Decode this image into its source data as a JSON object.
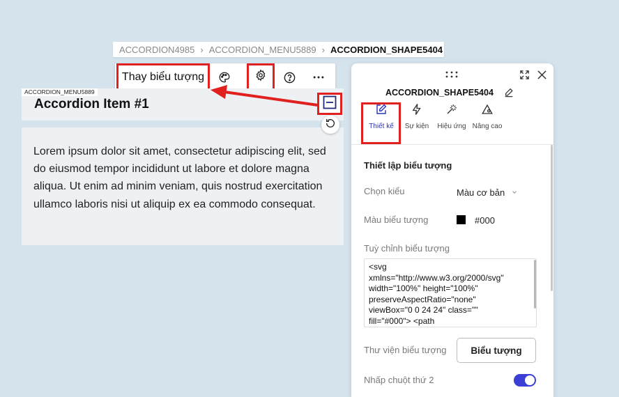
{
  "breadcrumb": {
    "items": [
      "ACCORDION4985",
      "ACCORDION_MENU5889"
    ],
    "current": "ACCORDION_SHAPE5404",
    "separator": "›"
  },
  "toolbar": {
    "change_icon_label": "Thay biểu tượng",
    "icons": [
      "palette-icon",
      "gear-icon",
      "help-icon",
      "more-icon"
    ]
  },
  "accordion": {
    "menu_tag": "ACCORDION_MENU5889",
    "item_title": "Accordion Item #1",
    "body_text": "Lorem ipsum dolor sit amet, consectetur adipiscing elit, sed do eiusmod tempor incididunt ut labore et dolore magna aliqua. Ut enim ad minim veniam, quis nostrud exercitation ullamco laboris nisi ut aliquip ex ea commodo consequat."
  },
  "panel": {
    "title": "ACCORDION_SHAPE5404",
    "tabs": [
      {
        "label": "Thiết kế",
        "icon": "edit-icon",
        "active": true
      },
      {
        "label": "Sự kiện",
        "icon": "bolt-icon",
        "active": false
      },
      {
        "label": "Hiệu ứng",
        "icon": "magic-wand-icon",
        "active": false
      },
      {
        "label": "Nâng cao",
        "icon": "advanced-gear-icon",
        "active": false
      }
    ],
    "section_title": "Thiết lập biểu tượng",
    "style_label": "Chọn kiểu",
    "style_value": "Màu cơ bản",
    "color_label": "Màu biểu tượng",
    "color_value": "#000",
    "custom_label": "Tuỳ chỉnh biểu tượng",
    "custom_code": "<svg\nxmlns=\"http://www.w3.org/2000/svg\"\nwidth=\"100%\" height=\"100%\"\npreserveAspectRatio=\"none\"\nviewBox=\"0 0 24 24\" class=\"\"\nfill=\"#000\"> <path",
    "library_label": "Thư viện biểu tượng",
    "library_button": "Biểu tượng",
    "right_click_label": "Nhấp chuột thứ 2",
    "right_click_on": true
  },
  "colors": {
    "background": "#d4e3ec",
    "highlight": "#e0211f",
    "accent": "#3b3fd6",
    "swatch": "#000000"
  }
}
